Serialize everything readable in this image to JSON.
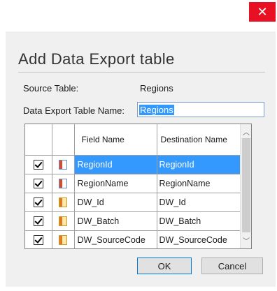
{
  "window": {
    "close_glyph": "✕"
  },
  "dialog": {
    "title": "Add Data Export table",
    "source_table_label": "Source Table:",
    "source_table_value": "Regions",
    "export_name_label": "Data Export Table Name:",
    "export_name_value": "Regions"
  },
  "grid": {
    "headers": {
      "field_name": "Field Name",
      "destination_name": "Destination Name"
    },
    "rows": [
      {
        "checked": true,
        "icon": "key-column-icon",
        "field": "RegionId",
        "destination": "RegionId",
        "selected": true
      },
      {
        "checked": true,
        "icon": "key-column-icon",
        "field": "RegionName",
        "destination": "RegionName",
        "selected": false
      },
      {
        "checked": true,
        "icon": "column-icon",
        "field": "DW_Id",
        "destination": "DW_Id",
        "selected": false
      },
      {
        "checked": true,
        "icon": "column-icon",
        "field": "DW_Batch",
        "destination": "DW_Batch",
        "selected": false
      },
      {
        "checked": true,
        "icon": "column-icon",
        "field": "DW_SourceCode",
        "destination": "DW_SourceCode",
        "selected": false
      }
    ],
    "scroll_up_glyph": "︿",
    "scroll_down_glyph": "﹀"
  },
  "buttons": {
    "ok": "OK",
    "cancel": "Cancel"
  },
  "colors": {
    "selection": "#3399ff",
    "close_button": "#e81123"
  }
}
